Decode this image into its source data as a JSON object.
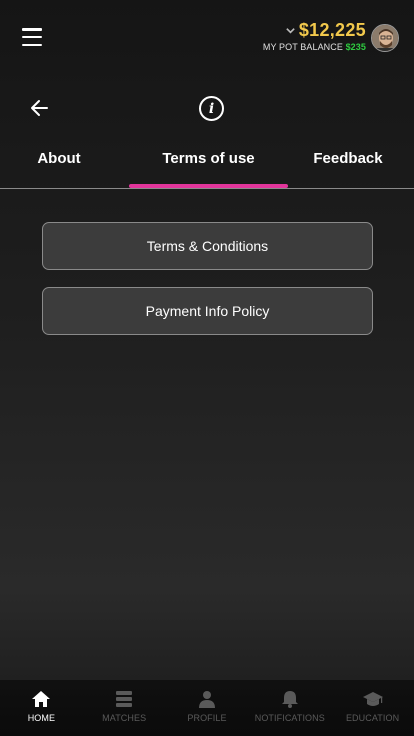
{
  "header": {
    "balance": "$12,225",
    "pot_label": "MY POT BALANCE",
    "pot_value": "$235"
  },
  "tabs": [
    {
      "label": "About",
      "active": false
    },
    {
      "label": "Terms of use",
      "active": true
    },
    {
      "label": "Feedback",
      "active": false
    }
  ],
  "documents": [
    {
      "label": "Terms & Conditions"
    },
    {
      "label": "Payment Info Policy"
    }
  ],
  "bottom_nav": [
    {
      "label": "HOME",
      "icon": "home-icon",
      "active": true
    },
    {
      "label": "MATCHES",
      "icon": "matches-icon",
      "active": false
    },
    {
      "label": "PROFILE",
      "icon": "profile-icon",
      "active": false
    },
    {
      "label": "NOTIFICATIONS",
      "icon": "bell-icon",
      "active": false
    },
    {
      "label": "EDUCATION",
      "icon": "graduation-cap-icon",
      "active": false
    }
  ],
  "colors": {
    "accent": "#e2359b",
    "balance": "#f2c94c",
    "pot": "#2ecc40"
  }
}
